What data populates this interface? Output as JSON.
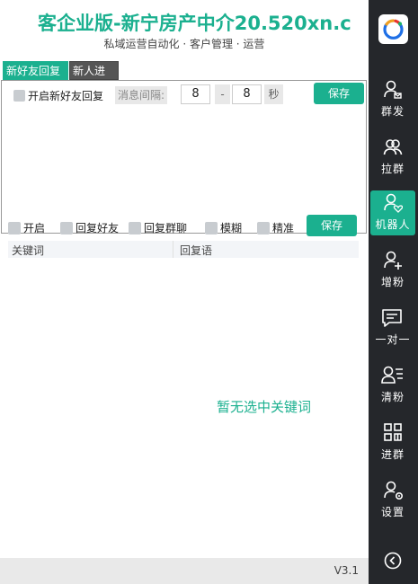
{
  "header": {
    "title": "客企业版-新宁房产中介20.520xn.c",
    "subtitle": "私域运营自动化 · 客户管理 · 运营"
  },
  "tabs": [
    {
      "label": "新好友回复",
      "active": true
    },
    {
      "label": "新人进群",
      "active": false
    }
  ],
  "greeting": {
    "enable_label": "开启新好友回复",
    "interval_label": "消息间隔:",
    "min_value": "8",
    "separator": "-",
    "max_value": "8",
    "unit": "秒",
    "save_label": "保存"
  },
  "keywords": {
    "options": [
      {
        "label": "开启"
      },
      {
        "label": "回复好友"
      },
      {
        "label": "回复群聊"
      },
      {
        "label": "模糊"
      },
      {
        "label": "精准"
      }
    ],
    "save_label": "保存",
    "columns": [
      "关键词",
      "回复语"
    ],
    "empty_text": "暂无选中关键词"
  },
  "footer": {
    "version": "V3.1"
  },
  "sidebar": {
    "items": [
      {
        "label": "群发",
        "icon": "person-send-icon"
      },
      {
        "label": "拉群",
        "icon": "group-icon"
      },
      {
        "label": "机器人",
        "icon": "robot-heart-icon",
        "active": true
      },
      {
        "label": "增粉",
        "icon": "person-add-icon"
      },
      {
        "label": "一对一",
        "icon": "chat-icon"
      },
      {
        "label": "清粉",
        "icon": "person-list-icon"
      },
      {
        "label": "进群",
        "icon": "grid-icon"
      },
      {
        "label": "设置",
        "icon": "person-settings-icon"
      }
    ]
  },
  "colors": {
    "accent": "#1bb08f",
    "sidebar": "#25272b"
  }
}
